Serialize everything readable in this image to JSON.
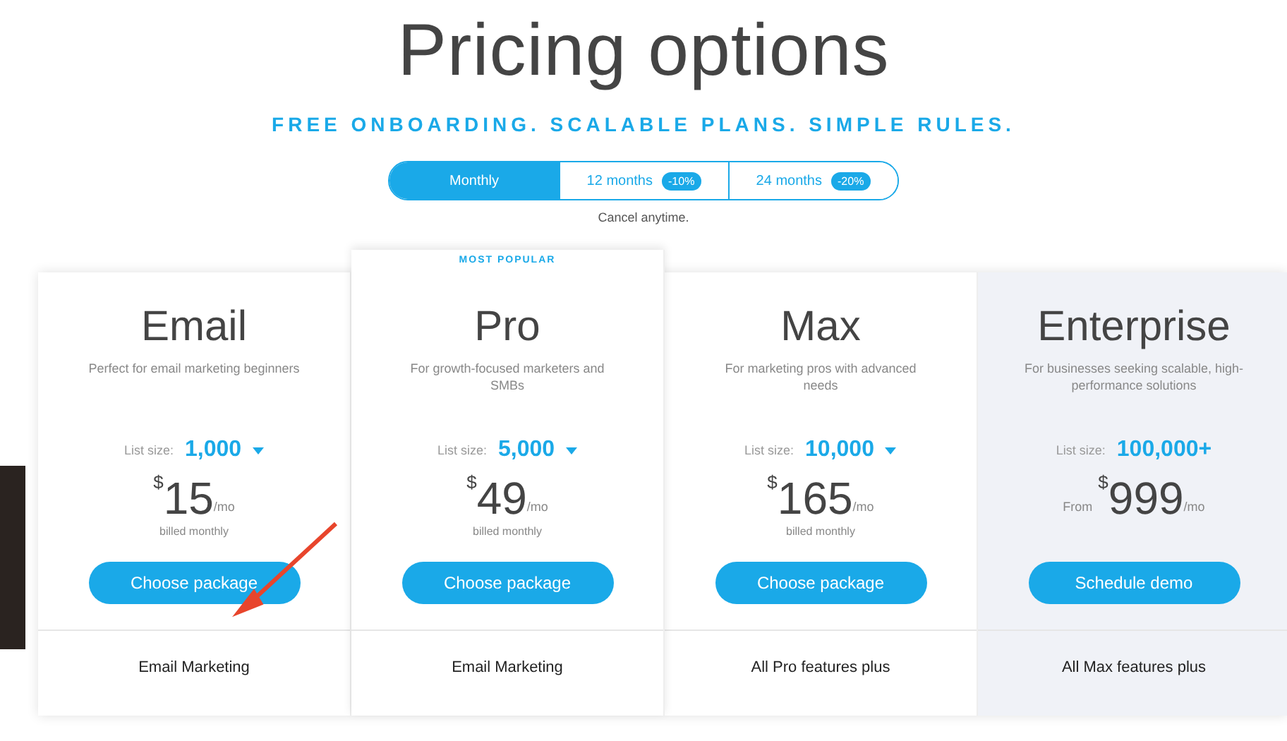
{
  "title": "Pricing options",
  "subtitle": "FREE ONBOARDING. SCALABLE PLANS. SIMPLE RULES.",
  "billing_toggle": [
    {
      "label": "Monthly",
      "selected": true
    },
    {
      "label": "12 months",
      "badge": "-10%",
      "selected": false
    },
    {
      "label": "24 months",
      "badge": "-20%",
      "selected": false
    }
  ],
  "note": "Cancel anytime.",
  "plans": [
    {
      "name": "Email",
      "shaded": false,
      "description": "Perfect for email marketing beginners",
      "list_label": "List size:",
      "list_value": "1,000",
      "dropdown": true,
      "currency": "$",
      "amount": "15",
      "period": "/mo",
      "billing": "billed monthly",
      "button": "Choose package",
      "feature": "Email Marketing"
    },
    {
      "name": "Pro",
      "ribbon": "MOST POPULAR",
      "shaded": false,
      "description": "For growth-focused marketers and SMBs",
      "list_label": "List size:",
      "list_value": "5,000",
      "dropdown": true,
      "currency": "$",
      "amount": "49",
      "period": "/mo",
      "billing": "billed monthly",
      "button": "Choose package",
      "feature": "Email Marketing"
    },
    {
      "name": "Max",
      "shaded": false,
      "description": "For marketing pros with advanced needs",
      "list_label": "List size:",
      "list_value": "10,000",
      "dropdown": true,
      "currency": "$",
      "amount": "165",
      "period": "/mo",
      "billing": "billed monthly",
      "button": "Choose package",
      "feature": "All Pro features plus"
    },
    {
      "name": "Enterprise",
      "shaded": true,
      "description": "For businesses seeking scalable, high-performance solutions",
      "list_label": "List size:",
      "list_value": "100,000+",
      "dropdown": false,
      "price_prefix": "From",
      "currency": "$",
      "amount": "999",
      "period": "/mo",
      "button": "Schedule demo",
      "feature": "All Max features plus"
    }
  ]
}
